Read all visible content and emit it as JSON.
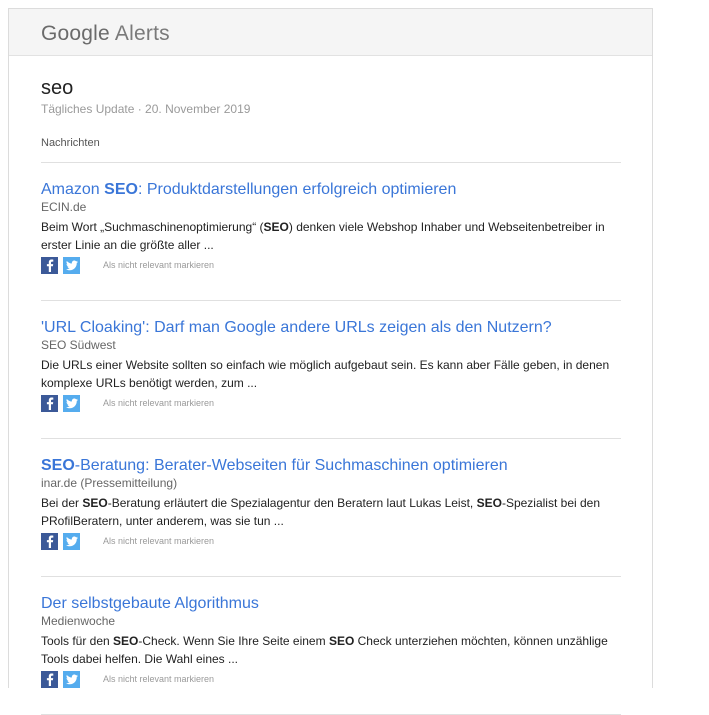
{
  "header": {
    "logo_google": "Google",
    "logo_alerts": "Alerts"
  },
  "alert": {
    "query": "seo",
    "subtitle": "Tägliches Update · 20. November 2019",
    "section_label": "Nachrichten"
  },
  "items": [
    {
      "title_parts": [
        [
          "Amazon ",
          false
        ],
        [
          "SEO",
          true
        ],
        [
          ": Produktdarstellungen erfolgreich optimieren",
          false
        ]
      ],
      "source": "ECIN.de",
      "snippet_parts": [
        [
          "Beim Wort „Suchmaschinenoptimierung“ (",
          false
        ],
        [
          "SEO",
          true
        ],
        [
          ") denken viele Webshop Inhaber und Webseitenbetreiber in erster Linie an die größte aller ...",
          false
        ]
      ],
      "irrelevant": "Als nicht relevant markieren"
    },
    {
      "title_parts": [
        [
          "'URL Cloaking': Darf man Google andere URLs zeigen als den Nutzern?",
          false
        ]
      ],
      "source": "SEO Südwest",
      "snippet_parts": [
        [
          "Die URLs einer Website sollten so einfach wie möglich aufgebaut sein. Es kann aber Fälle geben, in denen komplexe URLs benötigt werden, zum ...",
          false
        ]
      ],
      "irrelevant": "Als nicht relevant markieren"
    },
    {
      "title_parts": [
        [
          "SEO",
          true
        ],
        [
          "-Beratung: Berater-Webseiten für Suchmaschinen optimieren",
          false
        ]
      ],
      "source": "inar.de (Pressemitteilung)",
      "snippet_parts": [
        [
          "Bei der ",
          false
        ],
        [
          "SEO",
          true
        ],
        [
          "-Beratung erläutert die Spezialagentur den Beratern laut Lukas Leist, ",
          false
        ],
        [
          "SEO",
          true
        ],
        [
          "-Spezialist bei den PRofilBeratern, unter anderem, was sie tun ...",
          false
        ]
      ],
      "irrelevant": "Als nicht relevant markieren"
    },
    {
      "title_parts": [
        [
          "Der selbstgebaute Algorithmus",
          false
        ]
      ],
      "source": "Medienwoche",
      "snippet_parts": [
        [
          "Tools für den ",
          false
        ],
        [
          "SEO",
          true
        ],
        [
          "-Check. Wenn Sie Ihre Seite einem ",
          false
        ],
        [
          "SEO",
          true
        ],
        [
          " Check unterziehen möchten, können unzählige Tools dabei helfen. Die Wahl eines ...",
          false
        ]
      ],
      "irrelevant": "Als nicht relevant markieren"
    }
  ],
  "colors": {
    "link": "#3a76d8",
    "facebook": "#3b5998",
    "twitter": "#55acee"
  },
  "icons": [
    "facebook-icon",
    "twitter-icon"
  ]
}
